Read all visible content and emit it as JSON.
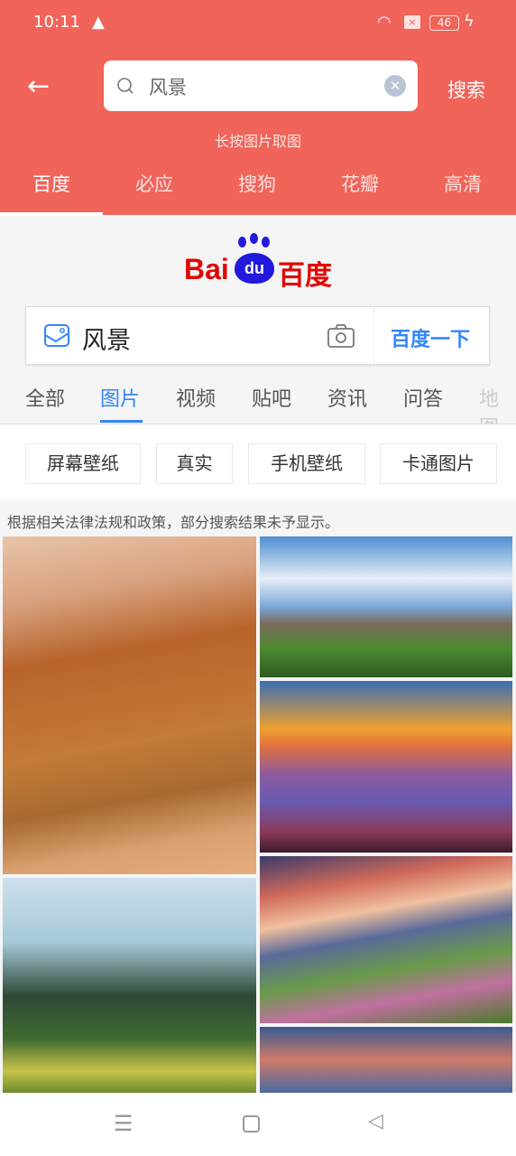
{
  "status_bar": {
    "time": "10:11",
    "battery": "46"
  },
  "header": {
    "query": "风景",
    "search_label": "搜索",
    "hint": "长按图片取图",
    "engines": [
      {
        "label": "百度",
        "active": true
      },
      {
        "label": "必应"
      },
      {
        "label": "搜狗"
      },
      {
        "label": "花瓣"
      },
      {
        "label": "高清"
      }
    ]
  },
  "baidu": {
    "logo": "Bai du 百度",
    "query": "风景",
    "submit": "百度一下",
    "tabs": [
      {
        "label": "全部"
      },
      {
        "label": "图片",
        "active": true
      },
      {
        "label": "视频"
      },
      {
        "label": "贴吧"
      },
      {
        "label": "资讯"
      },
      {
        "label": "问答"
      },
      {
        "label": "地图"
      }
    ],
    "chips": [
      "屏幕壁纸",
      "真实",
      "手机壁纸",
      "卡通图片"
    ],
    "notice": "根据相关法律法规和政策，部分搜索结果未予显示。",
    "images": [
      {
        "desc": "mountain"
      },
      {
        "desc": "sky-hills"
      },
      {
        "desc": "sunset-sea-of-clouds"
      },
      {
        "desc": "karst-peaks"
      },
      {
        "desc": "flower-meadow-sunset"
      },
      {
        "desc": "clouds"
      }
    ]
  },
  "colors": {
    "header": "#f0645a",
    "accent": "#3385ff",
    "baidu_red": "#e10602",
    "baidu_blue": "#2319dc"
  }
}
